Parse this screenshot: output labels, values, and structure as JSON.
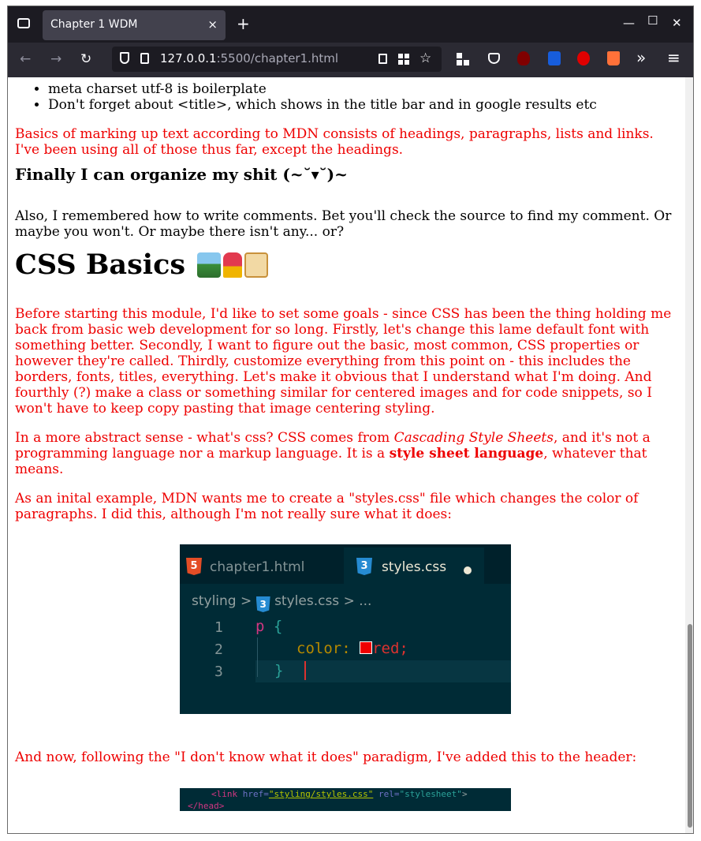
{
  "browser": {
    "tab_title": "Chapter 1 WDM",
    "tab_close": "×",
    "new_tab": "+",
    "url_host": "127.0.0.1",
    "url_path": ":5500/chapter1.html",
    "window_controls": {
      "minimize": "—",
      "maximize": "☐",
      "close": "✕"
    },
    "nav": {
      "back": "←",
      "forward": "→",
      "reload": "↻",
      "overflow": "»",
      "menu": "≡"
    }
  },
  "content": {
    "bullets": [
      "meta charset utf-8 is boilerplate",
      "Don't forget about <title>, which shows in the title bar and in google results etc"
    ],
    "para_mdn": "Basics of marking up text according to MDN consists of headings, paragraphs, lists and links. I've been using all of those thus far, except the headings.",
    "heading_organize": "Finally I can organize my shit (~˘▾˘)~",
    "para_comments": "Also, I remembered how to write comments. Bet you'll check the source to find my comment. Or maybe you won't. Or maybe there isn't any... or?",
    "heading_css": "CSS Basics",
    "para_goals": "Before starting this module, I'd like to set some goals - since CSS has been the thing holding me back from basic web development for so long. Firstly, let's change this lame default font with something better. Secondly, I want to figure out the basic, most common, CSS properties or however they're called. Thirdly, customize everything from this point on - this includes the borders, fonts, titles, everything. Let's make it obvious that I understand what I'm doing. And fourthly (?) make a class or something similar for centered images and for code snippets, so I won't have to keep copy pasting that image centering styling.",
    "para_css_a": "In a more abstract sense - what's css? CSS comes from ",
    "para_css_em": "Cascading Style Sheets",
    "para_css_b": ", and it's not a programming language nor a markup language. It is a ",
    "para_css_strong": "style sheet language",
    "para_css_c": ", whatever that means.",
    "para_example": "As an inital example, MDN wants me to create a \"styles.css\" file which changes the color of paragraphs. I did this, although I'm not really sure what it does:",
    "para_header": "And now, following the \"I don't know what it does\" paradigm, I've added this to the header:"
  },
  "editor_image": {
    "tab1_badge": "5",
    "tab1_label": "chapter1.html",
    "tab2_badge": "3",
    "tab2_label": "styles.css",
    "crumb_folder": "styling",
    "crumb_sep": ">",
    "crumb_file": "styles.css",
    "crumb_more": "> ...",
    "line_numbers": [
      "1",
      "2",
      "3"
    ],
    "line1_selector": "p",
    "line1_brace": "{",
    "line2_prop": "color:",
    "line2_value": "red;",
    "line3_brace": "}"
  },
  "header_image": {
    "open": "<link",
    "attr_href": "href=",
    "href_value": "\"styling/styles.css\"",
    "attr_rel": "rel=",
    "rel_value": "\"stylesheet\"",
    "close_tag": ">",
    "head_close": "</head>"
  },
  "colors": {
    "red_text": "#ee0000",
    "toolbar": "#2b2a33",
    "tabstrip": "#1c1b22",
    "editor_bg": "#002b36"
  }
}
